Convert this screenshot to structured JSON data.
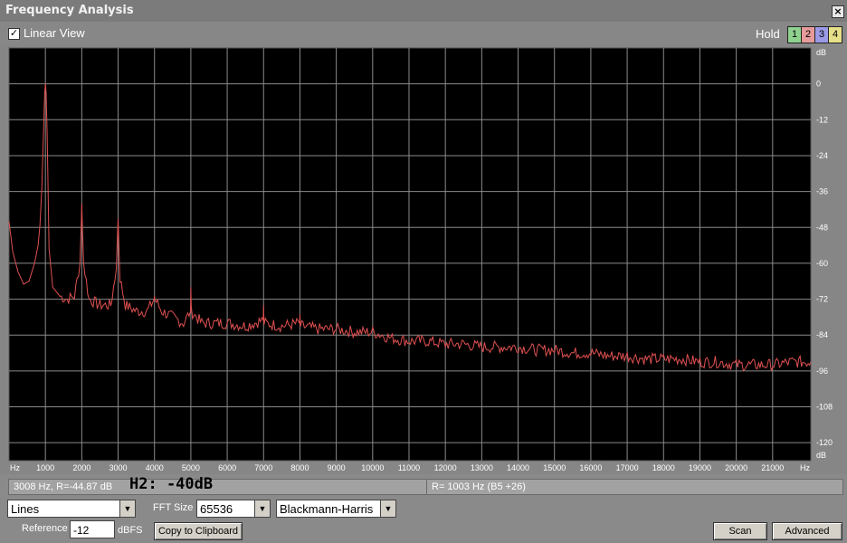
{
  "window": {
    "title": "Frequency Analysis",
    "close_label": "×"
  },
  "toolbar": {
    "linear_view_checked": true,
    "linear_view_check": "✓",
    "linear_view_label": "Linear View",
    "hold_label": "Hold",
    "hold_buttons": [
      {
        "label": "1",
        "color": "#8fd18f"
      },
      {
        "label": "2",
        "color": "#e69a9a"
      },
      {
        "label": "3",
        "color": "#9a9ae6"
      },
      {
        "label": "4",
        "color": "#e6e08a"
      }
    ]
  },
  "chart_data": {
    "type": "line",
    "x_unit": "Hz",
    "y_unit": "dB",
    "x_ticks": [
      1000,
      2000,
      3000,
      4000,
      5000,
      6000,
      7000,
      8000,
      9000,
      10000,
      11000,
      12000,
      13000,
      14000,
      15000,
      16000,
      17000,
      18000,
      19000,
      20000,
      21000
    ],
    "y_ticks": [
      0,
      -12,
      -24,
      -36,
      -48,
      -60,
      -72,
      -84,
      -96,
      -108,
      -120
    ],
    "xlim": [
      0,
      22050
    ],
    "ylim": [
      -126,
      12
    ],
    "grid": true,
    "line_color": "#e05050",
    "background": "#000000",
    "series": [
      {
        "x": [
          0,
          100,
          250,
          400,
          550,
          700,
          800,
          850,
          900,
          950,
          980,
          1000,
          1020,
          1050,
          1100,
          1200,
          1400,
          1600,
          1800,
          1950,
          1990,
          2000,
          2010,
          2050,
          2200,
          2500,
          2800,
          2950,
          2990,
          3000,
          3010,
          3050,
          3200,
          3500,
          3800,
          3990,
          4000,
          4010,
          4200,
          4500,
          4800,
          4990,
          5000,
          5010,
          5300,
          6000,
          6500,
          6990,
          7000,
          7010,
          7500,
          7990,
          8000,
          8010,
          8500,
          9000,
          9500,
          10000,
          10500,
          11000,
          11500,
          12000,
          12500,
          13000,
          13500,
          14000,
          14500,
          15000,
          15500,
          16000,
          16500,
          17000,
          17500,
          18000,
          18500,
          19000,
          19500,
          20000,
          20500,
          21000,
          21500,
          22050
        ],
        "y": [
          -46,
          -56,
          -63,
          -67,
          -66,
          -60,
          -54,
          -47,
          -35,
          -15,
          -3,
          0,
          -3,
          -18,
          -55,
          -68,
          -71,
          -72,
          -71,
          -60,
          -45,
          -40,
          -45,
          -60,
          -72,
          -74,
          -74,
          -62,
          -48,
          -45,
          -49,
          -65,
          -74,
          -76,
          -76,
          -72,
          -71,
          -72,
          -76,
          -78,
          -80,
          -76,
          -68,
          -76,
          -80,
          -80,
          -81,
          -79,
          -74,
          -80,
          -81,
          -80,
          -77,
          -81,
          -82,
          -82,
          -83,
          -83,
          -85,
          -86,
          -86,
          -87,
          -87,
          -88,
          -88,
          -88,
          -89,
          -89,
          -90,
          -90,
          -91,
          -91,
          -92,
          -92,
          -92,
          -93,
          -93,
          -94,
          -94,
          -94,
          -93,
          -93
        ]
      }
    ]
  },
  "status": {
    "cursor_readout": "3008 Hz, R=-44.87 dB",
    "harmonic_label": "H2: -40dB",
    "right_readout": "R=   1003 Hz (B5 +26)"
  },
  "controls": {
    "display_mode": "Lines",
    "fft_size_label": "FFT Size",
    "fft_size": "65536",
    "window_function": "Blackmann-Harris",
    "reference_label": "Reference",
    "reference_value": "-12",
    "reference_unit": "dBFS",
    "copy_button": "Copy to Clipboard",
    "scan_button": "Scan",
    "advanced_button": "Advanced"
  }
}
